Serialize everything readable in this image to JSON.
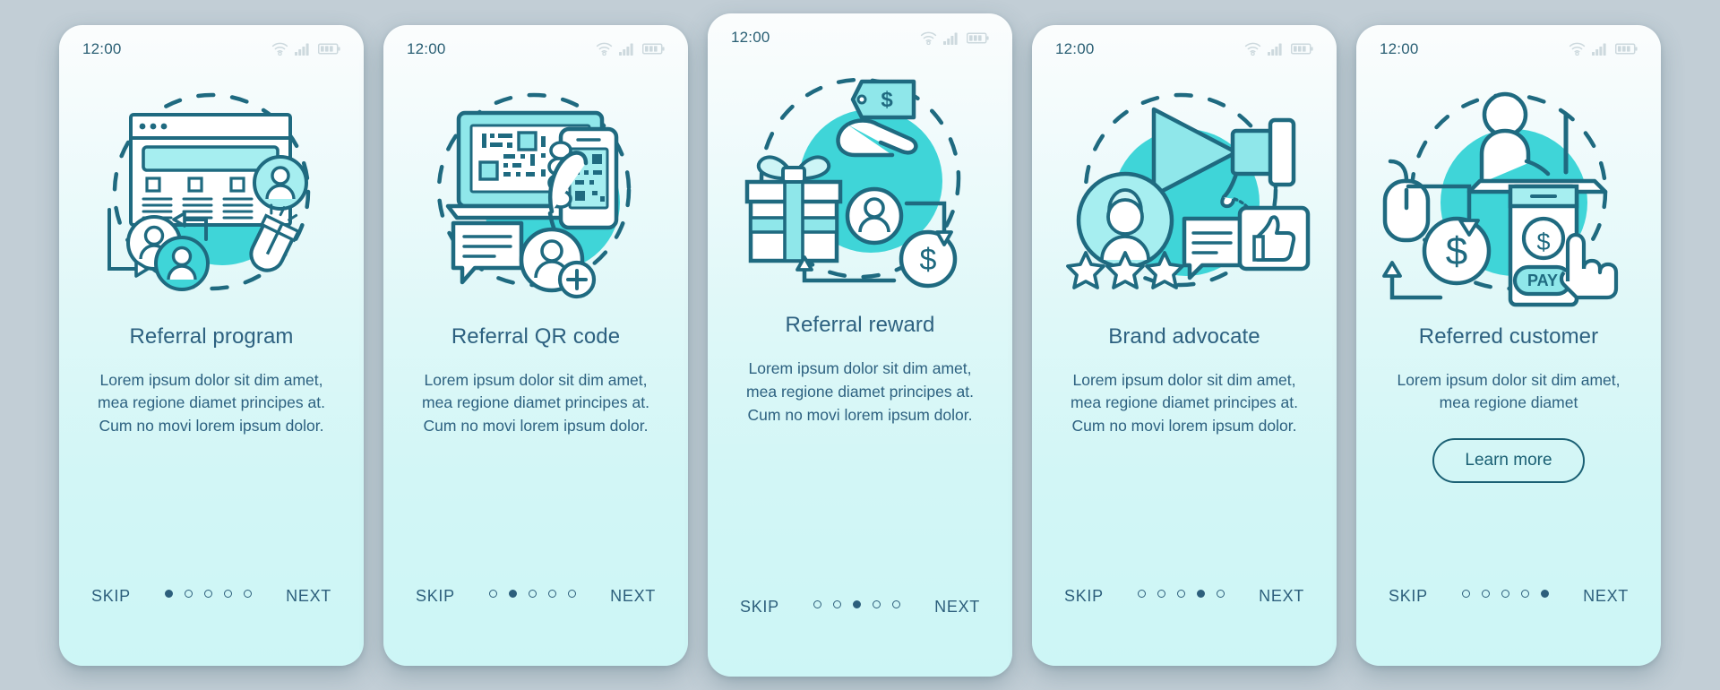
{
  "theme": {
    "accent": "#3fd5d8",
    "accent_light": "#9fe8ea",
    "stroke": "#1f6a80",
    "text": "#2d6180",
    "nav_text": "#2d5f7c",
    "page_bg": "#c2ced6"
  },
  "statusbar": {
    "time": "12:00",
    "icons": [
      "wifi-icon",
      "cellular-signal-icon",
      "battery-icon"
    ]
  },
  "nav": {
    "skip_label": "SKIP",
    "next_label": "NEXT",
    "dot_count": 5
  },
  "screens": [
    {
      "id": "referral-program",
      "title": "Referral program",
      "body": "Lorem ipsum dolor sit dim amet, mea regione diamet principes at. Cum no movi lorem ipsum dolor.",
      "active_dot": 1,
      "illustration": "referral-program-illustration",
      "cta": null
    },
    {
      "id": "referral-qr-code",
      "title": "Referral QR code",
      "body": "Lorem ipsum dolor sit dim amet, mea regione diamet principes at. Cum no movi lorem ipsum dolor.",
      "active_dot": 2,
      "illustration": "referral-qr-code-illustration",
      "cta": null
    },
    {
      "id": "referral-reward",
      "title": "Referral reward",
      "body": "Lorem ipsum dolor sit dim amet, mea regione diamet principes at. Cum no movi lorem ipsum dolor.",
      "active_dot": 3,
      "illustration": "referral-reward-illustration",
      "cta": null
    },
    {
      "id": "brand-advocate",
      "title": "Brand advocate",
      "body": "Lorem ipsum dolor sit dim amet, mea regione diamet principes at. Cum no movi lorem ipsum dolor.",
      "active_dot": 4,
      "illustration": "brand-advocate-illustration",
      "cta": null
    },
    {
      "id": "referred-customer",
      "title": "Referred customer",
      "body": "Lorem ipsum dolor sit dim amet, mea regione diamet",
      "active_dot": 5,
      "illustration": "referred-customer-illustration",
      "cta": "Learn more"
    }
  ]
}
